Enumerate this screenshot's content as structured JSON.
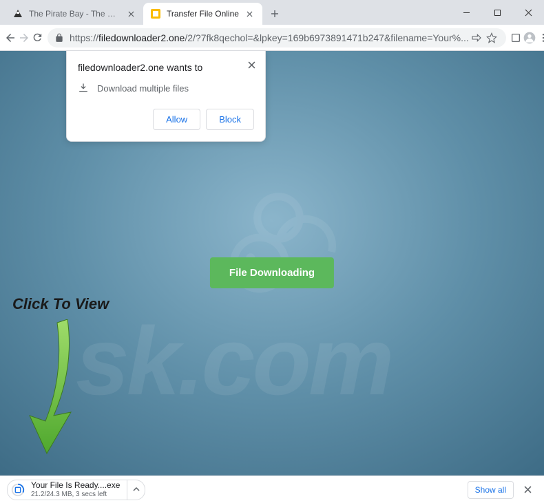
{
  "tabs": [
    {
      "title": "The Pirate Bay - The galaxy's mo…"
    },
    {
      "title": "Transfer File Online"
    }
  ],
  "url": {
    "protocol": "https://",
    "host": "filedownloader2.one",
    "path": "/2/?7fk8qechol=&lpkey=169b6973891471b247&filename=Your%..."
  },
  "permission": {
    "title": "filedownloader2.one wants to",
    "request": "Download multiple files",
    "allow": "Allow",
    "block": "Block"
  },
  "page": {
    "button": "File Downloading",
    "clickToView": "Click To View",
    "watermark": "sk.com"
  },
  "download_bar": {
    "filename": "Your File Is Ready....exe",
    "status": "21.2/24.3 MB, 3 secs left",
    "show_all": "Show all"
  }
}
